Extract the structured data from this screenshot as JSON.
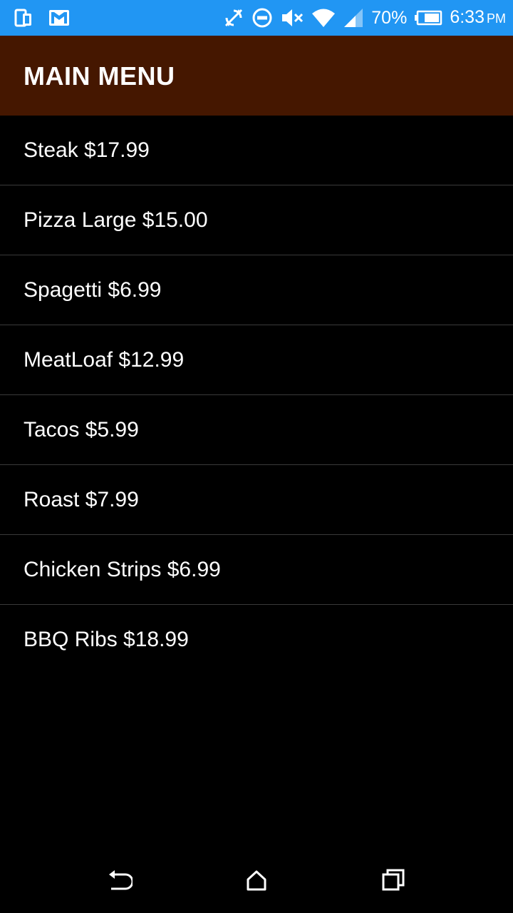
{
  "status_bar": {
    "color": "#2196F3",
    "battery_percent": "70%",
    "time": "6:33",
    "ampm": "PM",
    "left_icons": [
      "device-icon",
      "gmail-icon"
    ],
    "right_icons": [
      "sync-off-icon",
      "do-not-disturb-icon",
      "volume-mute-icon",
      "wifi-icon",
      "signal-icon",
      "battery-icon"
    ]
  },
  "app_bar": {
    "color": "#451700",
    "title": "MAIN MENU"
  },
  "menu": {
    "items": [
      {
        "label": "Steak $17.99"
      },
      {
        "label": "Pizza Large $15.00"
      },
      {
        "label": "Spagetti $6.99"
      },
      {
        "label": "MeatLoaf $12.99"
      },
      {
        "label": "Tacos $5.99"
      },
      {
        "label": "Roast $7.99"
      },
      {
        "label": "Chicken Strips $6.99"
      },
      {
        "label": "BBQ Ribs $18.99"
      }
    ]
  },
  "nav_bar": {
    "buttons": [
      "back-icon",
      "home-icon",
      "recents-icon"
    ]
  }
}
